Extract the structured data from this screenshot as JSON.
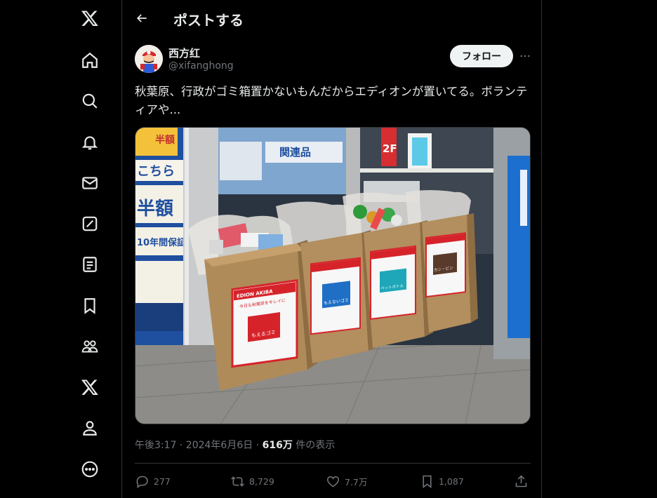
{
  "header": {
    "title": "ポストする"
  },
  "sidebar": {
    "items": [
      {
        "name": "x-logo-icon"
      },
      {
        "name": "home-icon"
      },
      {
        "name": "search-icon"
      },
      {
        "name": "notifications-icon"
      },
      {
        "name": "messages-icon"
      },
      {
        "name": "grok-icon"
      },
      {
        "name": "lists-icon"
      },
      {
        "name": "bookmarks-icon"
      },
      {
        "name": "communities-icon"
      },
      {
        "name": "premium-icon"
      },
      {
        "name": "profile-icon"
      },
      {
        "name": "more-icon"
      }
    ]
  },
  "post": {
    "author_name": "西方红",
    "author_handle": "@xifanghong",
    "follow_label": "フォロー",
    "text": "秋葉原、行政がゴミ箱置かないもんだからエディオンが置いてる。ボランティアや...",
    "time": "午後3:17 · 2024年6月6日 · ",
    "views_count": "616万",
    "views_label": " 件の表示"
  },
  "actions": {
    "replies": "277",
    "reposts": "8,729",
    "likes": "7.7万",
    "bookmarks": "1,087"
  },
  "photo": {
    "store_signs": [
      "半額",
      "こちら",
      "10年間保証",
      "関連品",
      "2F"
    ],
    "bin_header": "EDION AKIBA",
    "bin_headline": "今日も秋葉原をキレイに",
    "bin_labels": [
      "もえるゴミ",
      "もえないゴミ",
      "ペットボトル",
      "カン・ビン"
    ]
  },
  "colors": {
    "background": "#000000",
    "text": "#e7e9ea",
    "muted": "#71767b",
    "border": "#2f3336",
    "follow_bg": "#eff3f4"
  }
}
